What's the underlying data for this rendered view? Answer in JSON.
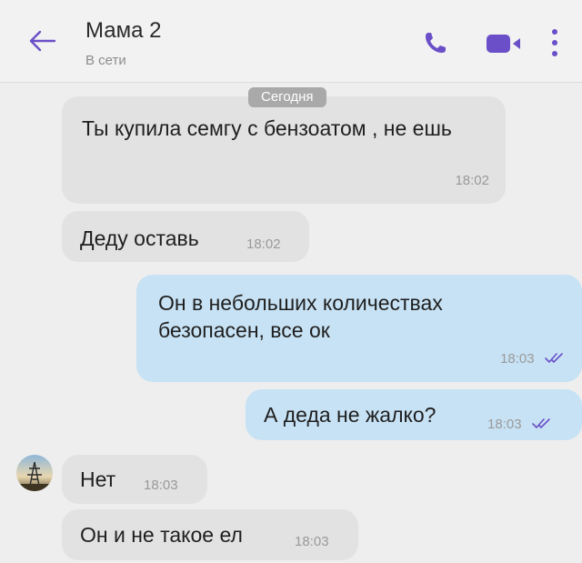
{
  "header": {
    "contact_name": "Мама 2",
    "status": "В сети",
    "icons": [
      "back-arrow-icon",
      "phone-icon",
      "video-camera-icon",
      "more-vert-icon"
    ],
    "accent_color": "#6a4fc8"
  },
  "date_divider": "Сегодня",
  "messages": [
    {
      "direction": "incoming",
      "text": "Ты купила семгу с бензоатом , не ешь",
      "time": "18:02"
    },
    {
      "direction": "incoming",
      "text": "Деду оставь",
      "time": "18:02"
    },
    {
      "direction": "outgoing",
      "text": "Он в небольших количествах безопасен, все ок",
      "time": "18:03",
      "status": "read"
    },
    {
      "direction": "outgoing",
      "text": "А деда не жалко?",
      "time": "18:03",
      "status": "read"
    },
    {
      "direction": "incoming",
      "text": "Нет",
      "time": "18:03",
      "avatar": true
    },
    {
      "direction": "incoming",
      "text": "Он и не такое ел",
      "time": "18:03"
    }
  ],
  "colors": {
    "incoming_bubble": "#e2e2e2",
    "outgoing_bubble": "#c7e2f4",
    "background": "#eeeeee"
  }
}
